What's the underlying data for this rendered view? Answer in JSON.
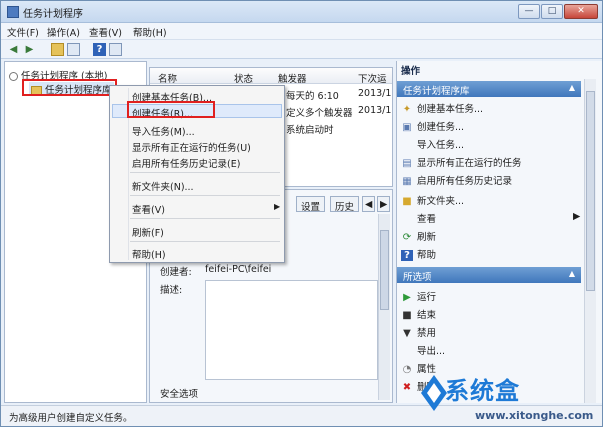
{
  "window": {
    "title": "任务计划程序",
    "min": "—",
    "max": "□",
    "close": "✕"
  },
  "menu": [
    "文件(F)",
    "操作(A)",
    "查看(V)",
    "帮助(H)"
  ],
  "toolbar": {
    "icons": [
      "back-icon",
      "forward-icon",
      "up-folder-icon",
      "console-tree-icon",
      "help-icon",
      "show-hide-icon"
    ]
  },
  "tree": {
    "root": "任务计划程序 (本地)",
    "child": "任务计划程序库"
  },
  "task_list": {
    "columns": [
      "名称",
      "状态",
      "触发器",
      "下次运"
    ],
    "rows": [
      {
        "trigger": "每天的 6:10",
        "next": "2013/1"
      },
      {
        "trigger": "定义多个触发器",
        "next": "2013/1"
      },
      {
        "trigger": "系统启动时",
        "next": ""
      }
    ]
  },
  "detail": {
    "tabs": [
      "设置",
      "历史",
      "◀",
      "▶"
    ],
    "creator_label": "创建者:",
    "creator_value": "feifei-PC\\feifei",
    "desc_label": "描述:",
    "security_label": "安全选项"
  },
  "context_menu": {
    "items": [
      "创建基本任务(B)...",
      "创建任务(R)...",
      "导入任务(M)...",
      "显示所有正在运行的任务(U)",
      "启用所有任务历史记录(E)",
      "新文件夹(N)...",
      "查看(V)",
      "刷新(F)",
      "帮助(H)"
    ],
    "submenu_arrow": "▶"
  },
  "actions": {
    "header": "操作",
    "section1": "任务计划程序库",
    "section1_items": [
      "创建基本任务...",
      "创建任务...",
      "导入任务...",
      "显示所有正在运行的任务",
      "启用所有任务历史记录",
      "新文件夹...",
      "查看",
      "刷新",
      "帮助"
    ],
    "section2": "所选项",
    "section2_items": [
      "运行",
      "结束",
      "禁用",
      "导出...",
      "属性",
      "删除"
    ],
    "collapse_arrow": "▲",
    "submenu_arrow": "▶"
  },
  "status": "为高级用户创建自定义任务。",
  "watermark": {
    "logo": "系统盒",
    "url": "www.xitonghe.com"
  },
  "colors": {
    "highlight_box": "#e02020",
    "section_header": "#4077bc"
  }
}
